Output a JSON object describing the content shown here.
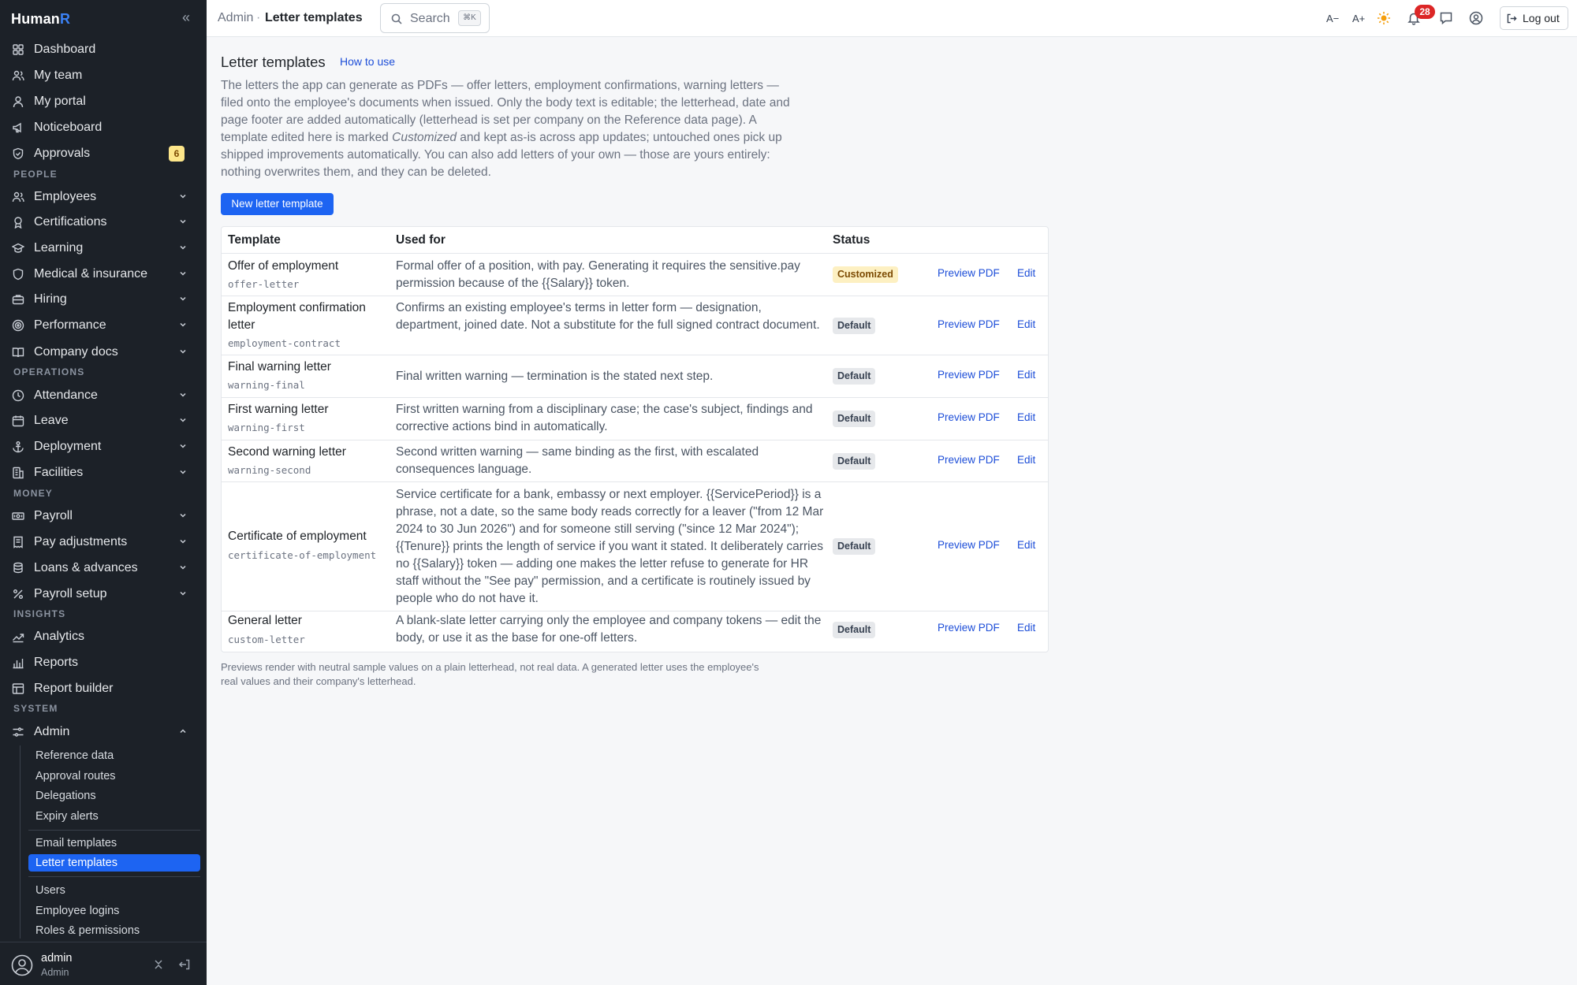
{
  "app": {
    "name_main": "Human",
    "name_accent": "R"
  },
  "sidebar": {
    "collapse_icon": "double-chevron-left-icon",
    "primary": [
      {
        "label": "Dashboard",
        "icon": "grid-icon"
      },
      {
        "label": "My team",
        "icon": "people-icon"
      },
      {
        "label": "My portal",
        "icon": "person-icon"
      },
      {
        "label": "Noticeboard",
        "icon": "megaphone-icon"
      },
      {
        "label": "Approvals",
        "icon": "shield-check-icon",
        "badge": "6"
      }
    ],
    "sections": [
      {
        "label": "PEOPLE",
        "items": [
          {
            "label": "Employees"
          },
          {
            "label": "Certifications"
          },
          {
            "label": "Learning"
          },
          {
            "label": "Medical & insurance"
          },
          {
            "label": "Hiring"
          },
          {
            "label": "Performance"
          },
          {
            "label": "Company docs"
          }
        ]
      },
      {
        "label": "OPERATIONS",
        "items": [
          {
            "label": "Attendance"
          },
          {
            "label": "Leave"
          },
          {
            "label": "Deployment"
          },
          {
            "label": "Facilities"
          }
        ]
      },
      {
        "label": "MONEY",
        "items": [
          {
            "label": "Payroll"
          },
          {
            "label": "Pay adjustments"
          },
          {
            "label": "Loans & advances"
          },
          {
            "label": "Payroll setup"
          }
        ]
      },
      {
        "label": "INSIGHTS",
        "items": [
          {
            "label": "Analytics"
          },
          {
            "label": "Reports"
          },
          {
            "label": "Report builder"
          }
        ]
      },
      {
        "label": "SYSTEM",
        "items": [
          {
            "label": "Admin"
          }
        ]
      }
    ],
    "admin_sub": {
      "group1": [
        "Reference data",
        "Approval routes",
        "Delegations",
        "Expiry alerts"
      ],
      "group2": [
        "Email templates",
        "Letter templates"
      ],
      "group3": [
        "Users",
        "Employee logins",
        "Roles & permissions"
      ],
      "active": "Letter templates"
    },
    "user": {
      "name": "admin",
      "role": "Admin"
    }
  },
  "topbar": {
    "breadcrumb_root": "Admin",
    "breadcrumb_sep": "·",
    "breadcrumb_current": "Letter templates",
    "search_label": "Search",
    "search_shortcut": "⌘K",
    "font_decrease": "A−",
    "font_increase": "A+",
    "notification_count": "28",
    "logout_label": "Log out"
  },
  "main": {
    "title": "Letter templates",
    "how_to_use": "How to use",
    "intro_part1": "The letters the app can generate as PDFs — offer letters, employment confirmations, warning letters — filed onto the employee's documents when issued. Only the body text is editable; the letterhead, date and page footer are added automatically (letterhead is set per company on the Reference data page). A template edited here is marked ",
    "intro_em": "Customized",
    "intro_part2": " and kept as-is across app updates; untouched ones pick up shipped improvements automatically. You can also add letters of your own — those are yours entirely: nothing overwrites them, and they can be deleted.",
    "new_button": "New letter template",
    "table": {
      "headers": {
        "template": "Template",
        "used_for": "Used for",
        "status": "Status"
      },
      "action_preview": "Preview PDF",
      "action_edit": "Edit",
      "rows": [
        {
          "name": "Offer of employment",
          "key": "offer-letter",
          "used_for": "Formal offer of a position, with pay. Generating it requires the sensitive.pay permission because of the {{Salary}} token.",
          "status": "Customized"
        },
        {
          "name": "Employment confirmation letter",
          "key": "employment-contract",
          "used_for": "Confirms an existing employee's terms in letter form — designation, department, joined date. Not a substitute for the full signed contract document.",
          "status": "Default"
        },
        {
          "name": "Final warning letter",
          "key": "warning-final",
          "used_for": "Final written warning — termination is the stated next step.",
          "status": "Default"
        },
        {
          "name": "First warning letter",
          "key": "warning-first",
          "used_for": "First written warning from a disciplinary case; the case's subject, findings and corrective actions bind in automatically.",
          "status": "Default"
        },
        {
          "name": "Second warning letter",
          "key": "warning-second",
          "used_for": "Second written warning — same binding as the first, with escalated consequences language.",
          "status": "Default"
        },
        {
          "name": "Certificate of employment",
          "key": "certificate-of-employment",
          "used_for": "Service certificate for a bank, embassy or next employer. {{ServicePeriod}} is a phrase, not a date, so the same body reads correctly for a leaver (\"from 12 Mar 2024 to 30 Jun 2026\") and for someone still serving (\"since 12 Mar 2024\"); {{Tenure}} prints the length of service if you want it stated. It deliberately carries no {{Salary}} token — adding one makes the letter refuse to generate for HR staff without the \"See pay\" permission, and a certificate is routinely issued by people who do not have it.",
          "status": "Default"
        },
        {
          "name": "General letter",
          "key": "custom-letter",
          "used_for": "A blank-slate letter carrying only the employee and company tokens — edit the body, or use it as the base for one-off letters.",
          "status": "Default"
        }
      ]
    },
    "footnote": "Previews render with neutral sample values on a plain letterhead, not real data. A generated letter uses the employee's real values and their company's letterhead."
  }
}
